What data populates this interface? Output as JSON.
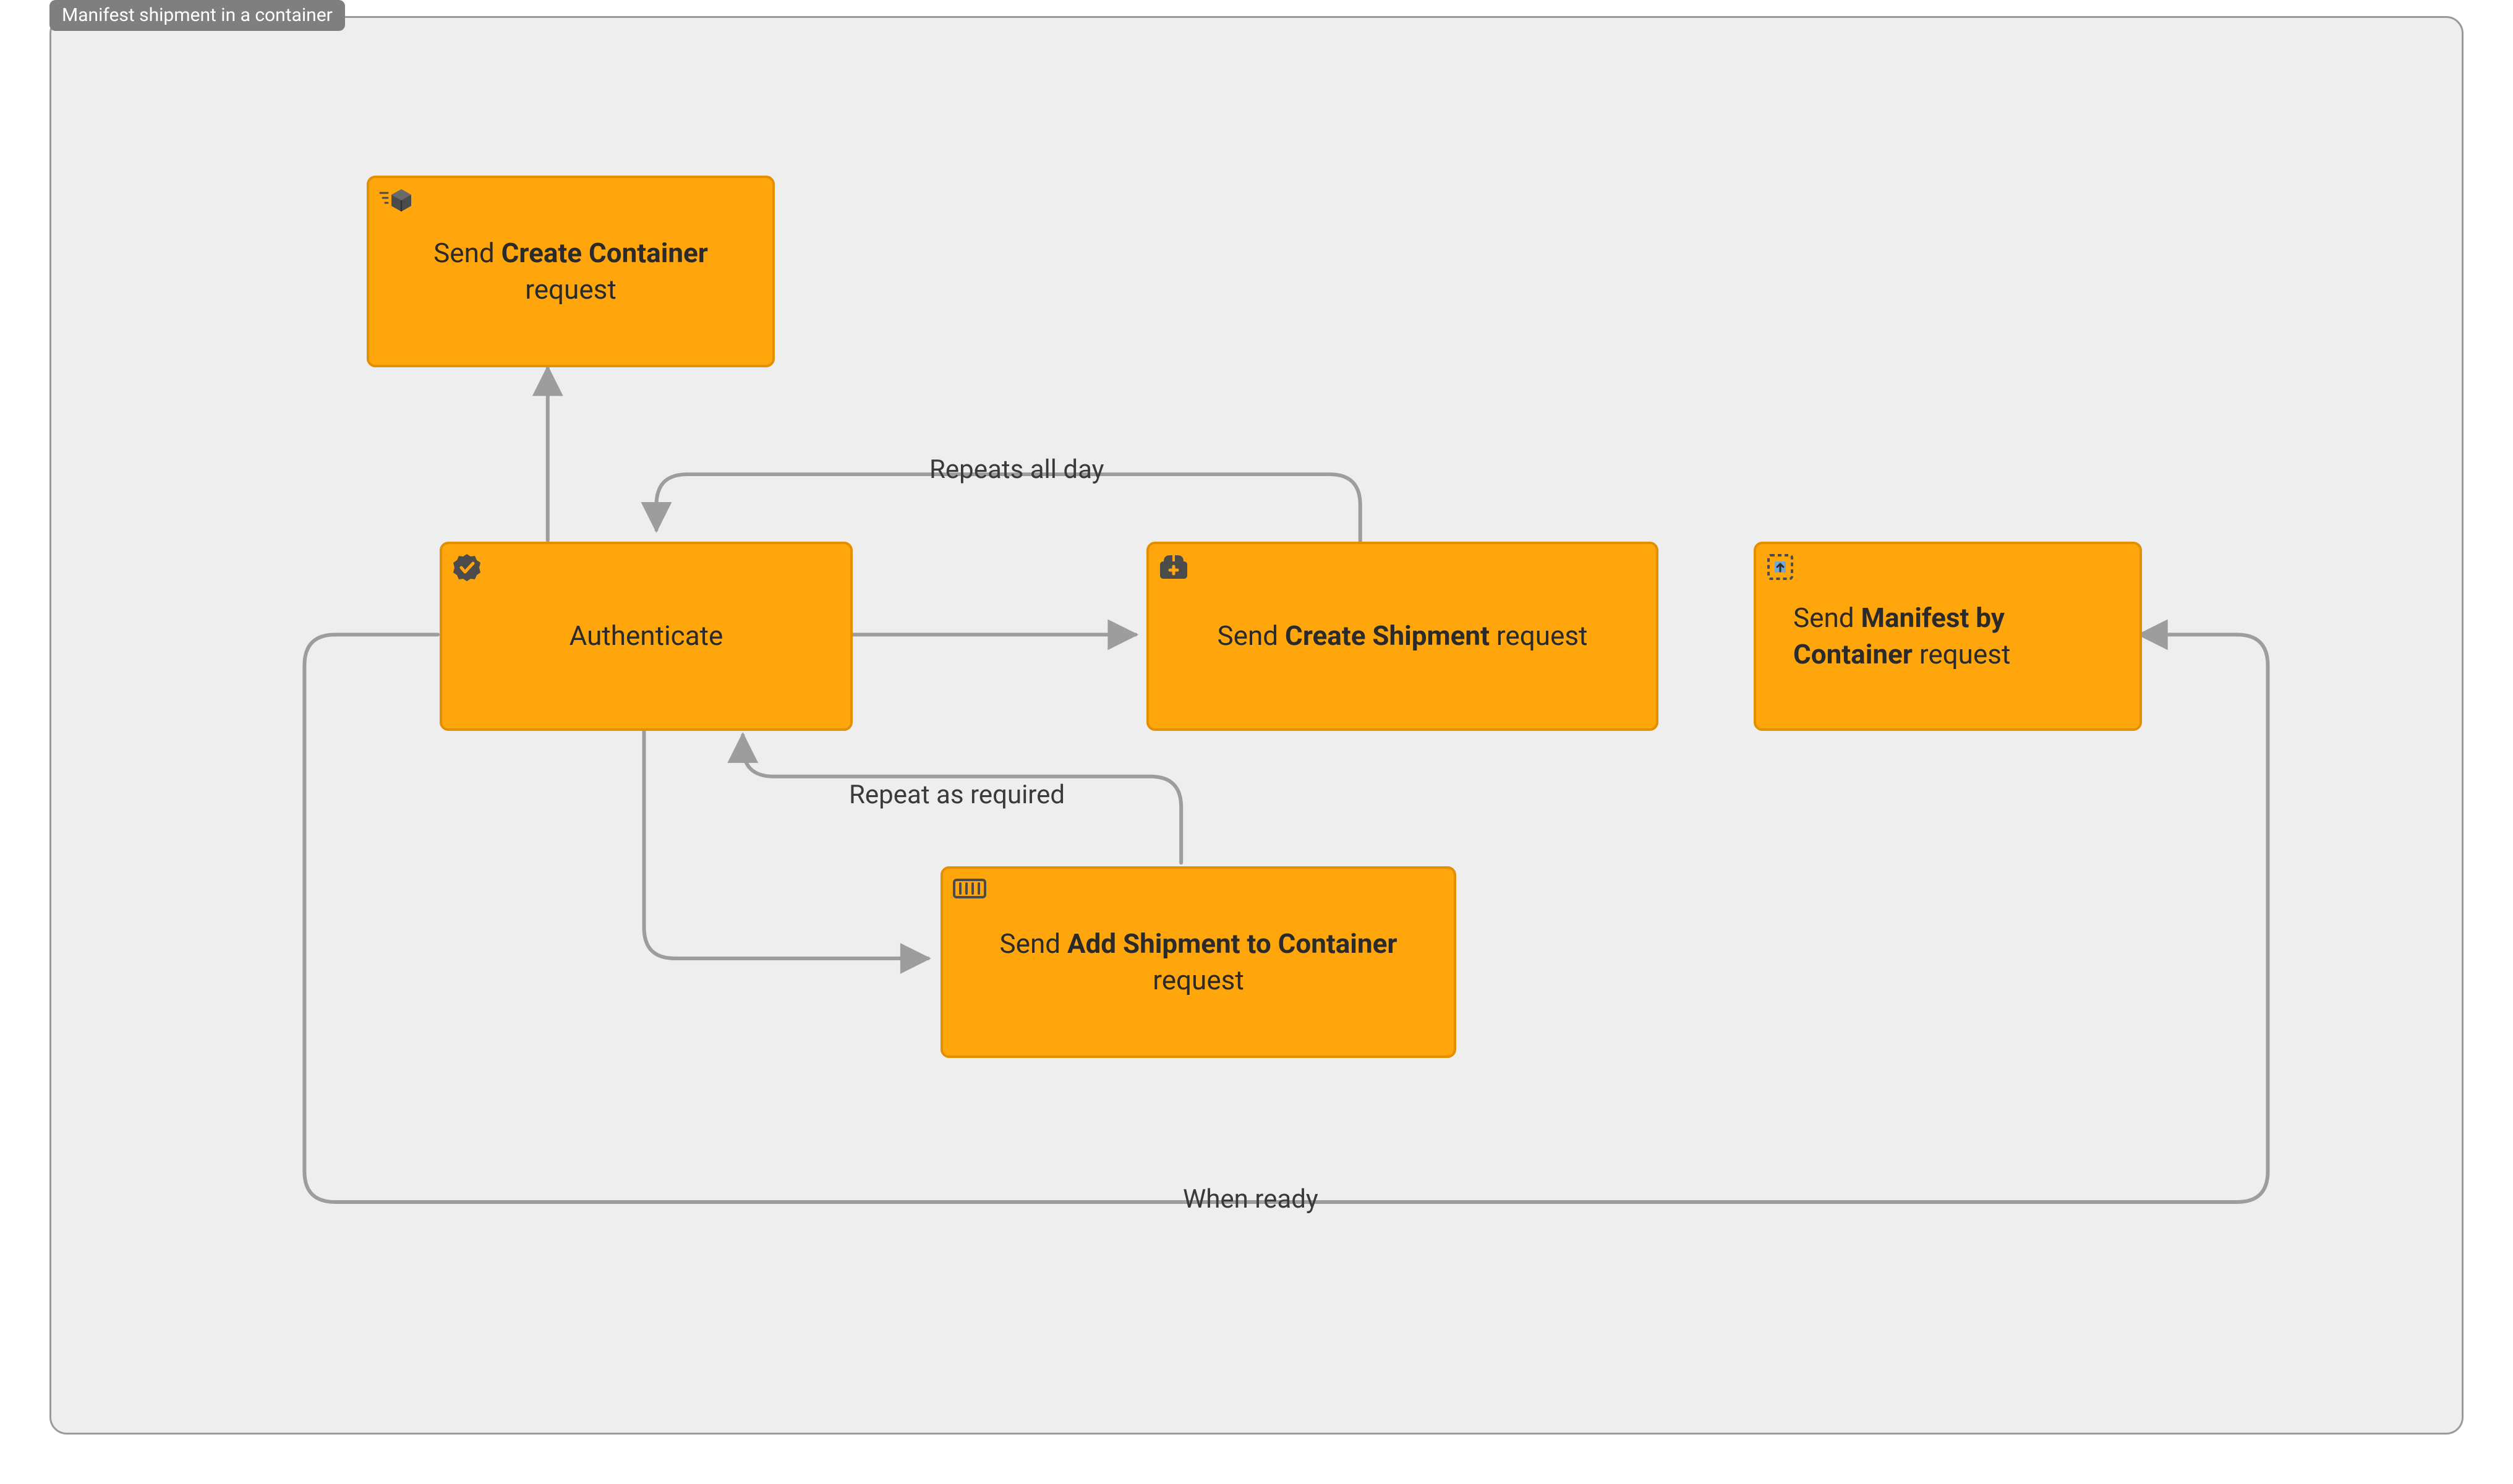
{
  "diagram": {
    "title": "Manifest shipment in a container",
    "nodes": {
      "createContainer": {
        "prefix": "Send ",
        "bold": "Create Container",
        "suffix": " request"
      },
      "authenticate": {
        "prefix": "",
        "bold": "",
        "suffix": "Authenticate"
      },
      "createShipment": {
        "prefix": "Send ",
        "bold": "Create Shipment",
        "suffix": " request"
      },
      "addShipment": {
        "prefix": "Send ",
        "bold": "Add Shipment to Container",
        "suffix": " request"
      },
      "manifest": {
        "prefix": "Send ",
        "bold": "Manifest by Container",
        "suffix": " request"
      }
    },
    "edges": {
      "repeatsAllDay": "Repeats all day",
      "repeatAsRequired": "Repeat as required",
      "whenReady": "When ready"
    }
  }
}
